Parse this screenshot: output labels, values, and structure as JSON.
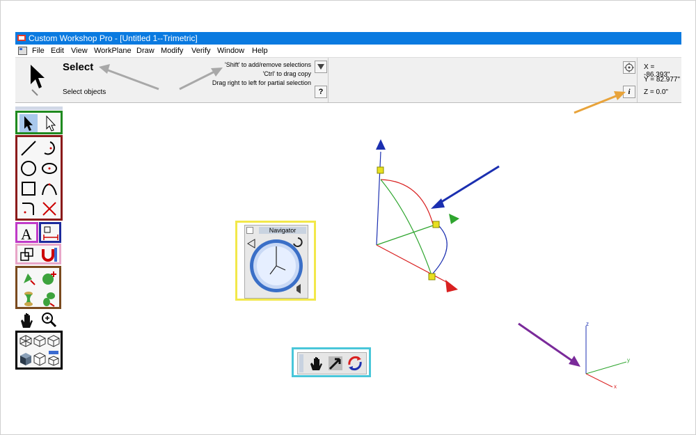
{
  "window": {
    "title": "Custom Workshop Pro - [Untitled 1--Trimetric]"
  },
  "menu": [
    "File",
    "Edit",
    "View",
    "WorkPlane",
    "Draw",
    "Modify",
    "Verify",
    "Window",
    "Help"
  ],
  "context_bar": {
    "tool_title": "Select",
    "tool_desc": "Select objects",
    "hints": [
      "'Shift' to add/remove selections",
      "'Ctrl' to drag copy",
      "Drag right to left for partial selection"
    ],
    "help_button": "?",
    "info_button": "i",
    "x_label": "X = -86.393\"",
    "y_label": "Y = 82.977\"",
    "z_label": "Z = 0.0\""
  },
  "navigator": {
    "title": "Navigator"
  },
  "axes_small": {
    "z": "z",
    "y": "y",
    "x": "x"
  },
  "colors": {
    "titlebar": "#0a7ae0",
    "group_green": "#1f8a1f",
    "group_red": "#8b1a1a",
    "group_magenta": "#c03ac8",
    "group_blue": "#1c2a9c",
    "group_pink": "#e8a6c8",
    "group_brown": "#7a4a1e",
    "group_black": "#000000",
    "navigator_border": "#f2e84a",
    "viewbar_border": "#49c6d9",
    "arrow_gray": "#a8a8a8",
    "arrow_blue": "#1b2fb0",
    "arrow_orange": "#e8a33a",
    "arrow_purple": "#7a2a9a"
  },
  "icons": {
    "select_tool": "cursor-arrow-icon",
    "palette": [
      "select-arrow-icon",
      "select-hollow-arrow-icon",
      "line-icon",
      "arc-icon",
      "circle-icon",
      "ellipse-icon",
      "rectangle-icon",
      "spline-icon",
      "fillet-icon",
      "trim-icon",
      "text-icon",
      "dimension-icon",
      "boolean-icon",
      "snap-magnet-icon",
      "extrude-icon",
      "add-solid-icon",
      "revolve-icon",
      "loft-icon",
      "pan-hand-icon",
      "zoom-icon",
      "wireframe-cube-icon",
      "wireframe-cube-2-icon",
      "wireframe-cube-3-icon",
      "shaded-cube-icon",
      "hidden-line-cube-icon",
      "render-cube-icon"
    ],
    "viewbar": [
      "hand-icon",
      "rotate-view-icon",
      "orbit-icon"
    ]
  }
}
